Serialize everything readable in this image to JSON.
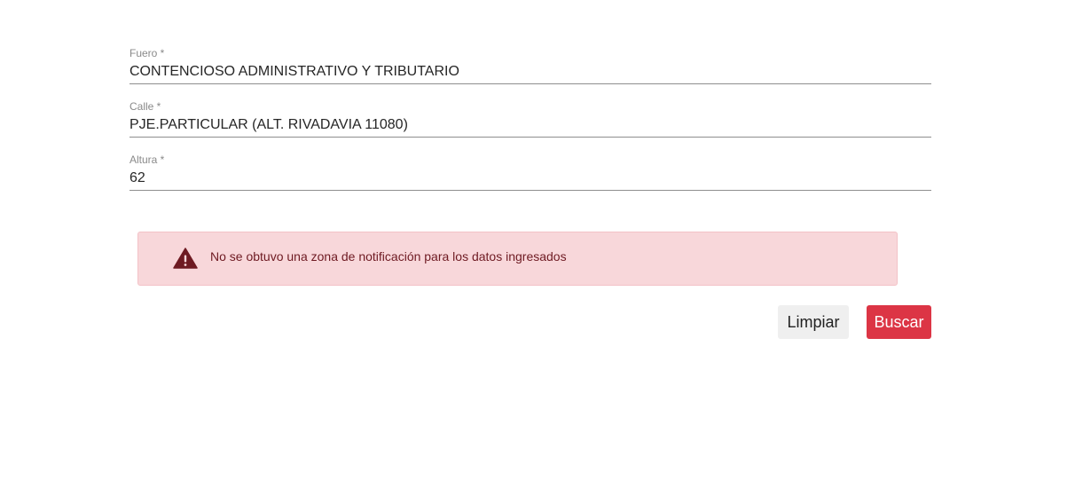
{
  "form": {
    "fuero": {
      "label": "Fuero *",
      "value": "CONTENCIOSO ADMINISTRATIVO Y TRIBUTARIO"
    },
    "calle": {
      "label": "Calle *",
      "value": "PJE.PARTICULAR (ALT. RIVADAVIA 11080)"
    },
    "altura": {
      "label": "Altura *",
      "value": "62"
    }
  },
  "alert": {
    "icon": "warning-icon",
    "message": "No se obtuvo una zona de notificación para los datos ingresados",
    "background": "#f8d7da",
    "text_color": "#6e1a22"
  },
  "actions": {
    "clear_label": "Limpiar",
    "search_label": "Buscar",
    "search_color": "#dc3545"
  }
}
